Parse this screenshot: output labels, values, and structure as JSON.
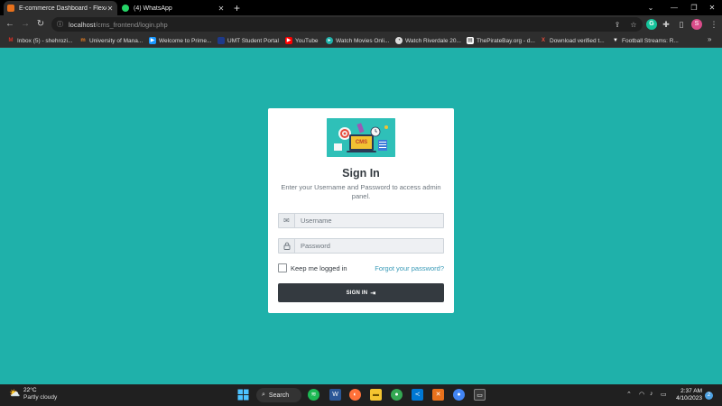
{
  "browser": {
    "tabs": [
      {
        "title": "E-commerce Dashboard - FlexAd",
        "favicon_color": "#e8711c",
        "active": true
      },
      {
        "title": "(4) WhatsApp",
        "favicon_color": "#25d366",
        "active": false
      }
    ],
    "new_tab_label": "+",
    "url_host": "localhost",
    "url_path": "/cms_frontend/login.php",
    "bookmarks": [
      {
        "label": "Inbox (5) - shehrozi...",
        "icon": "gmail-icon",
        "color": "#d93025"
      },
      {
        "label": "University of Mana...",
        "icon": "university-icon",
        "color": "#e67e22"
      },
      {
        "label": "Welcome to Prime...",
        "icon": "prime-icon",
        "color": "#1a98ff"
      },
      {
        "label": "UMT Student Portal",
        "icon": "umt-icon",
        "color": "#1e3a8a"
      },
      {
        "label": "YouTube",
        "icon": "youtube-icon",
        "color": "#ff0000"
      },
      {
        "label": "Watch Movies Onli...",
        "icon": "movies-icon",
        "color": "#1fb1aa"
      },
      {
        "label": "Watch Riverdale 20...",
        "icon": "riverdale-icon",
        "color": "#666666"
      },
      {
        "label": "ThePirateBay.org - d...",
        "icon": "piratebay-icon",
        "color": "#999999"
      },
      {
        "label": "Download verified t...",
        "icon": "download-icon",
        "color": "#e74c3c"
      },
      {
        "label": "Football Streams: R...",
        "icon": "football-icon",
        "color": "#ffffff"
      }
    ],
    "profile_initial": "S"
  },
  "login": {
    "logo_text": "CMS",
    "title": "Sign In",
    "subtitle": "Enter your Username and Password to access admin panel.",
    "username_placeholder": "Username",
    "password_placeholder": "Password",
    "remember_label": "Keep me logged in",
    "forgot_label": "Forgot your password?",
    "submit_label": "SIGN IN"
  },
  "taskbar": {
    "weather_temp": "22°C",
    "weather_desc": "Partly cloudy",
    "search_label": "Search",
    "time": "2:37 AM",
    "date": "4/10/2023",
    "notification_count": "2"
  },
  "colors": {
    "page_background": "#1fb1aa",
    "button_dark": "#343a40",
    "link": "#3a9bb8"
  }
}
